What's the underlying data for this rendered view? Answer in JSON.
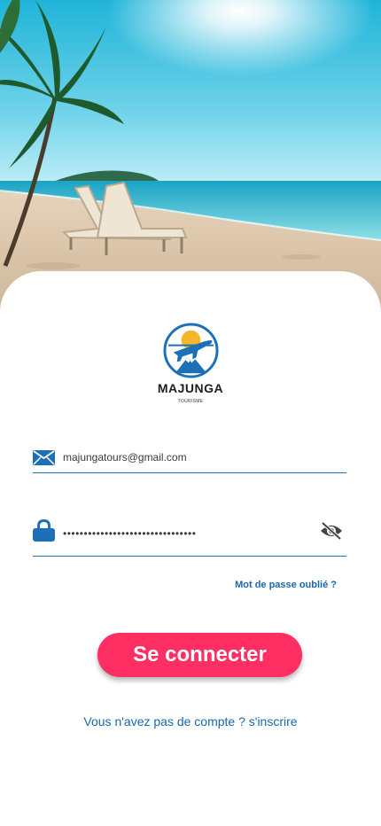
{
  "brand": {
    "name": "MAJUNGA",
    "tagline": "TOURISME"
  },
  "login": {
    "email_value": "majungatours@gmail.com",
    "password_value": "••••••••••••••••••••••••••••••••",
    "forgot_label": "Mot de passe oublié ?",
    "submit_label": "Se connecter",
    "signup_label": "Vous n'avez pas de compte ? s'inscrire"
  },
  "icons": {
    "email": "envelope-icon",
    "password": "lock-icon",
    "visibility": "eye-slash-icon"
  },
  "colors": {
    "accent": "#1867ae",
    "button": "#ff2e63",
    "field_line": "#1e73b6"
  }
}
